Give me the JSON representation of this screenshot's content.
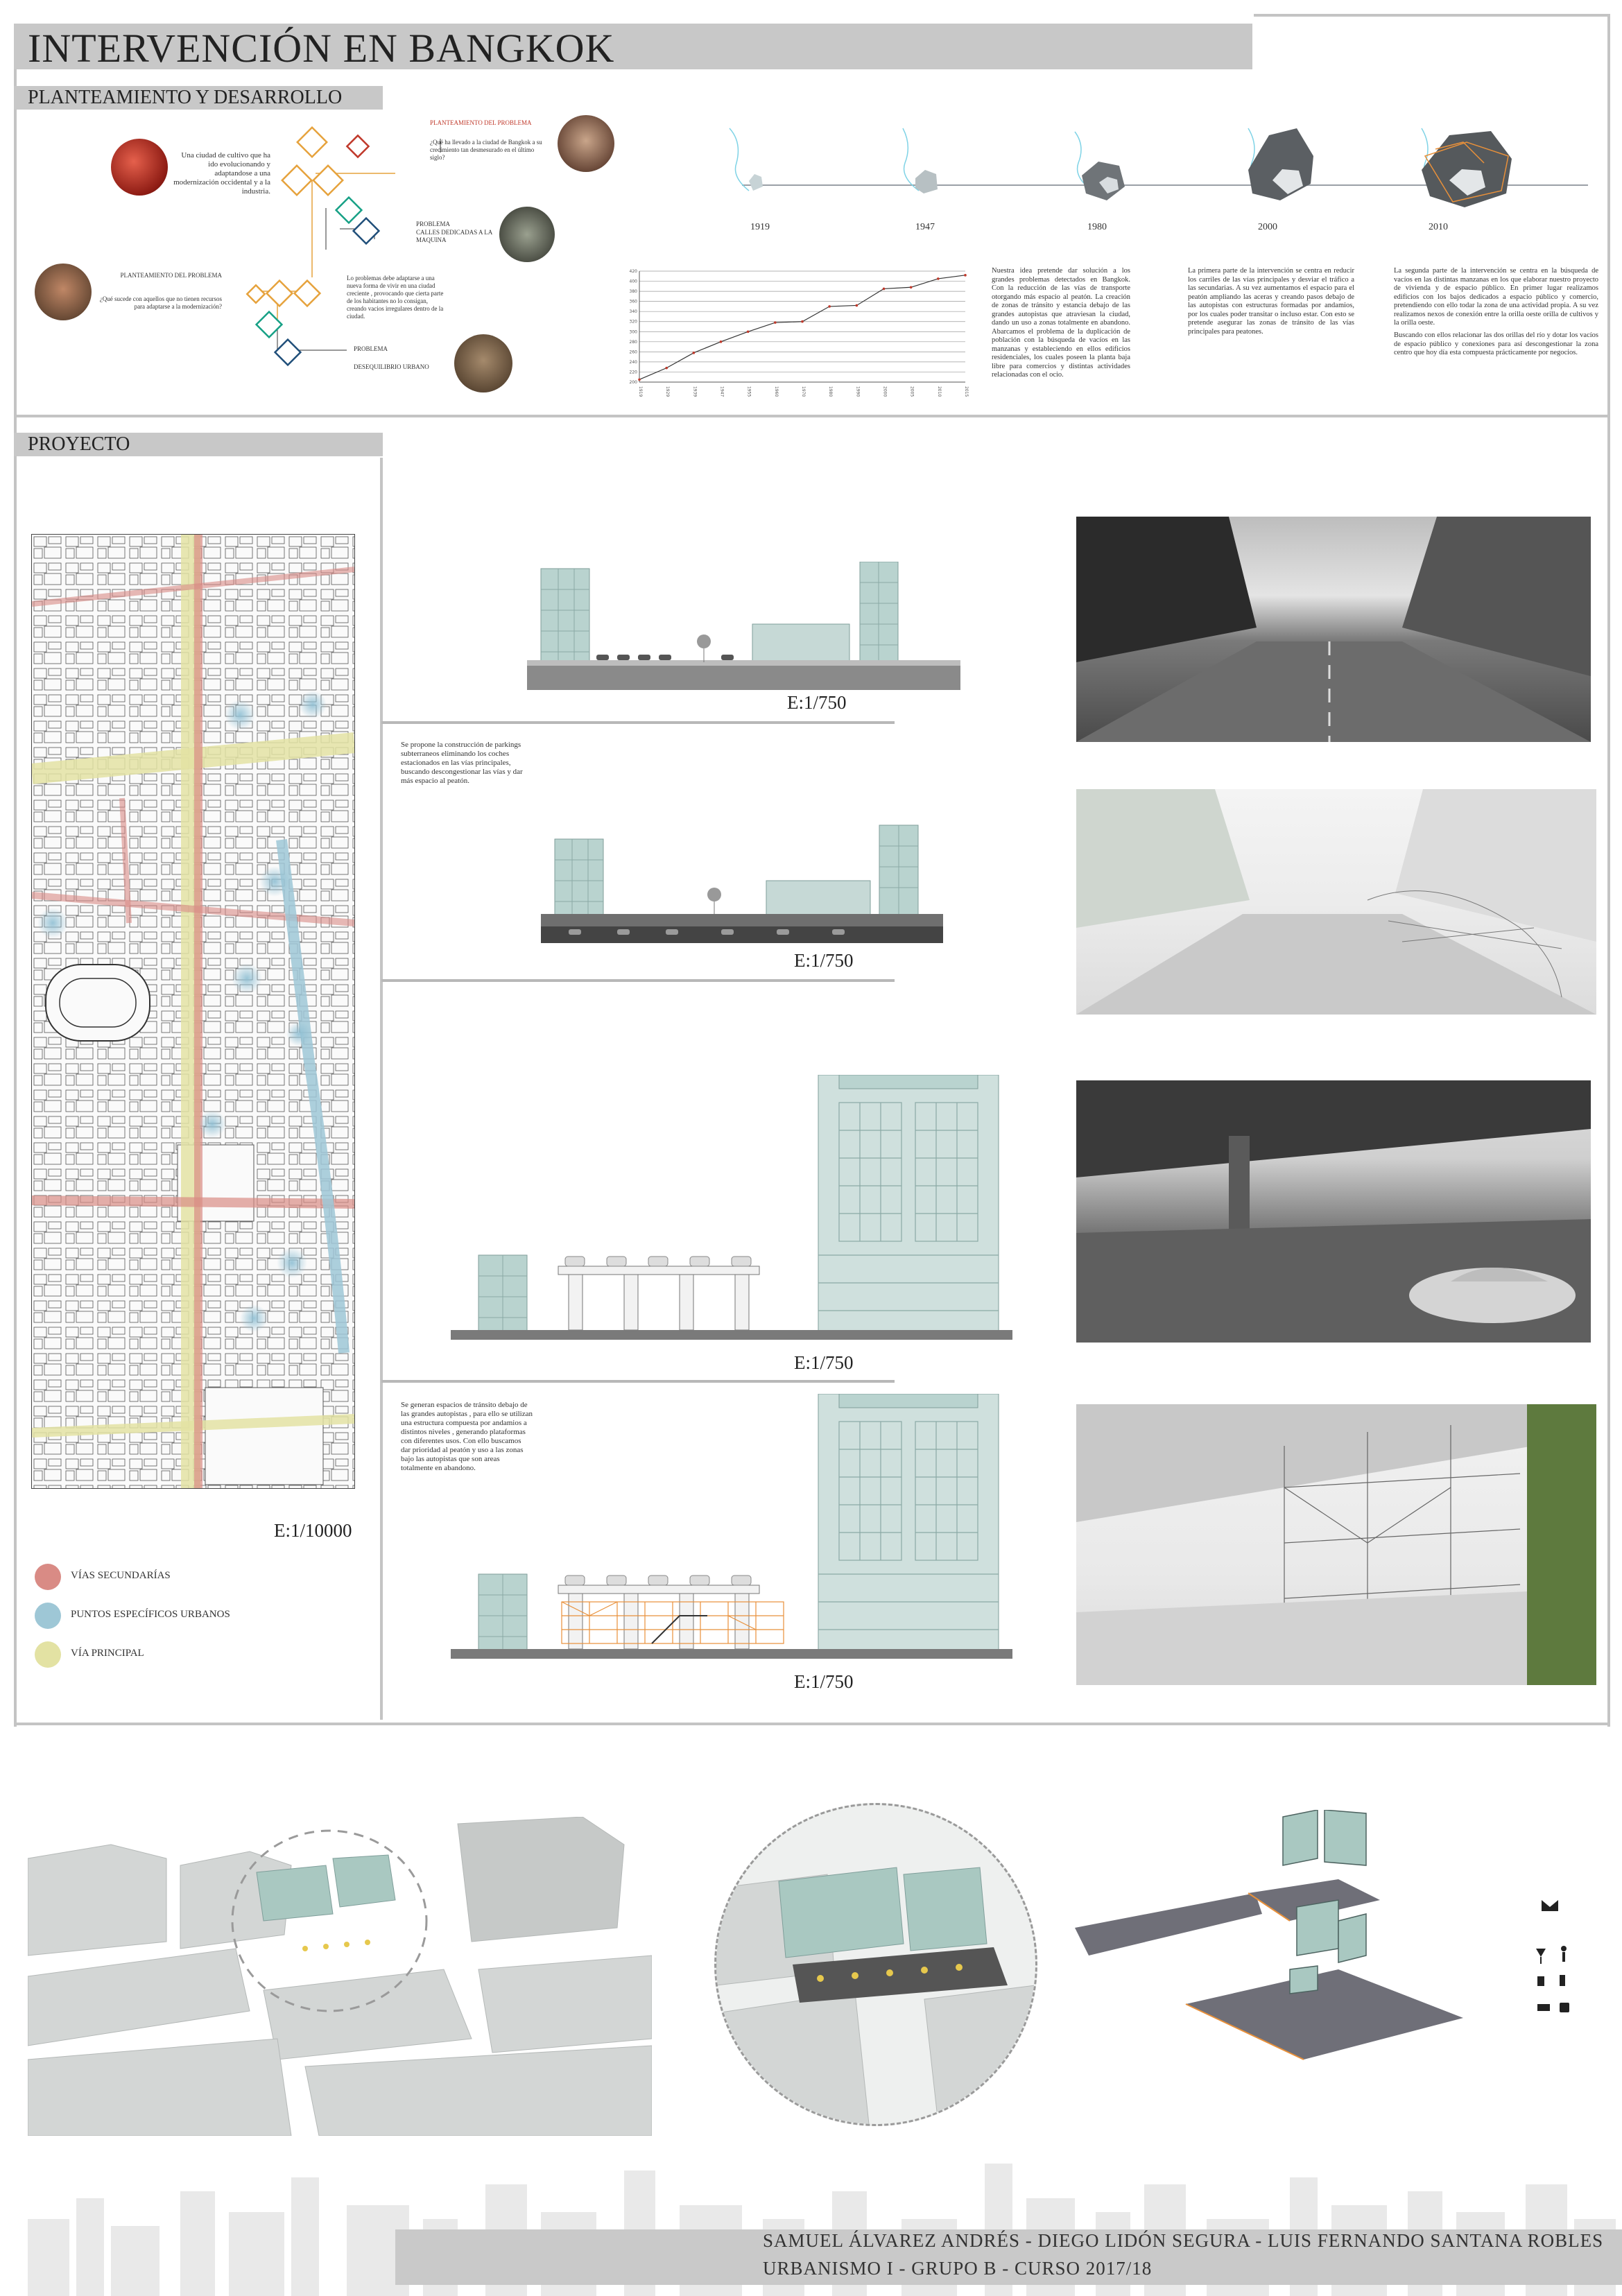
{
  "header": {
    "title": "INTERVENCIÓN EN BANGKOK",
    "section1": "PLANTEAMIENTO Y DESARROLLO",
    "section2": "PROYECTO"
  },
  "diagram": {
    "problem1_title": "PLANTEAMIENTO DEL PROBLEMA",
    "problem1_text": "¿Qué ha llevado a la ciudad de Bangkok a su crecimiento tan desmesurado en el último siglo?",
    "left1_text": "Una ciudad de cultivo que ha ido evolucionando y adaptandose a una modernización occidental y a la industria.",
    "problem2_title": "PLANTEAMIENTO DEL PROBLEMA",
    "problem2_text": "¿Qué sucede con aquellos que no tienen recursos para adaptarse a la modernización?",
    "center_text": "Lo problemas debe adaptarse a una nueva forma de vivir en una ciudad creciente , provocando que cierta parte de los habitantes no lo consigan, creando vacios irregulares dentro de la ciudad.",
    "prob_a_label": "PROBLEMA",
    "prob_a_text": "CALLES DEDICADAS A LA MAQUINA",
    "prob_b_label": "PROBLEMA",
    "prob_b_text": "DESEQUILIBRIO URBANO"
  },
  "timeline": {
    "years": [
      "1919",
      "1947",
      "1980",
      "2000",
      "2010"
    ]
  },
  "chart_data": {
    "type": "line",
    "title": "",
    "xlabel": "",
    "ylabel": "",
    "y_ticks": [
      "200",
      "220",
      "240",
      "260",
      "280",
      "300",
      "320",
      "340",
      "360",
      "380",
      "400",
      "420"
    ],
    "x_ticks": [
      "1919",
      "1929",
      "1939",
      "1947",
      "1955",
      "1960",
      "1970",
      "1980",
      "1990",
      "2000",
      "2005",
      "2010",
      "2015"
    ],
    "series": [
      {
        "values": [
          205,
          228,
          258,
          280,
          300,
          318,
          320,
          350,
          352,
          385,
          388,
          405,
          412
        ]
      }
    ],
    "ylim": [
      200,
      420
    ]
  },
  "texts": {
    "col1": "Nuestra idea pretende dar solución a los grandes problemas detectados en Bangkok. Con la reducción de las vías de transporte otorgando más espacio al peatón. La creación de zonas de tránsito y estancia debajo de las grandes autopistas que atraviesan la ciudad, dando un uso a zonas totalmente en abandono. Abarcamos el problema de la duplicación de población con la búsqueda de vacíos en las manzanas y estableciendo en ellos edificios residenciales, los cuales poseen la planta baja libre para comercios y distintas actividades relacionadas con el ocio.",
    "col2": "La primera parte de la intervención se centra en reducir los carriles de las vías principales y desviar el tráfico a las secundarias. A su vez aumentamos el espacio para el peatón ampliando las aceras y creando pasos debajo de las autopistas con estructuras formadas por andamios, por los cuales poder transitar o incluso estar. Con esto se pretende asegurar las zonas de tránsito de las vías principales para peatones.",
    "col3a": "La segunda parte de la intervención se centra en la búsqueda de vacíos en las distintas manzanas en los que elaborar nuestro proyecto de vivienda y de espacio público. En primer lugar realizamos edificios con los bajos dedicados a espacio público y comercio, pretendiendo con ello todar la zona de una actividad propia. A su vez realizamos nexos de conexión entre la orilla oeste orilla de cultivos y la orilla oeste.",
    "col3b": "Buscando con ellos relacionar las dos orillas del río y dotar los vacíos de espacio público y conexiones para así descongestionar la zona centro que hoy día esta compuesta prácticamente por negocios."
  },
  "project": {
    "map_scale": "E:1/10000",
    "legend": [
      {
        "label": "VÍAS SECUNDARÍAS",
        "color": "#d98b85"
      },
      {
        "label": "PUNTOS ESPECÍFICOS URBANOS",
        "color": "#9ec7d6"
      },
      {
        "label": "VÍA PRINCIPAL",
        "color": "#e3e2a3"
      }
    ],
    "sections": [
      {
        "scale": "E:1/750",
        "note": ""
      },
      {
        "scale": "E:1/750",
        "note": "Se propone la construcción de parkings subterraneos eliminando los coches estacionados en las vías principales, buscando descongestionar las vías y dar más espacio al peatón."
      },
      {
        "scale": "E:1/750",
        "note": ""
      },
      {
        "scale": "E:1/750",
        "note": "Se generan espacios de tránsito debajo de las grandes autopistas , para ello se utilizan una estructura compuesta por andamios a distintos niveles , generando plataformas con diferentes usos. Con ello buscamos dar prioridad al peatón y uso a las zonas bajo las autopistas que son areas totalmente en abandono."
      }
    ]
  },
  "footer": {
    "authors": "SAMUEL ÁLVAREZ ANDRÉS  -  DIEGO LIDÓN SEGURA  -  LUIS FERNANDO SANTANA ROBLES",
    "course": "URBANISMO I - GRUPO B - CURSO 2017/18"
  },
  "colors": {
    "band": "#c8c8c8",
    "frame": "#c4c4c4",
    "building": "#b9d3cf",
    "accent_red": "#c0392b",
    "accent_orange": "#e8903a"
  }
}
